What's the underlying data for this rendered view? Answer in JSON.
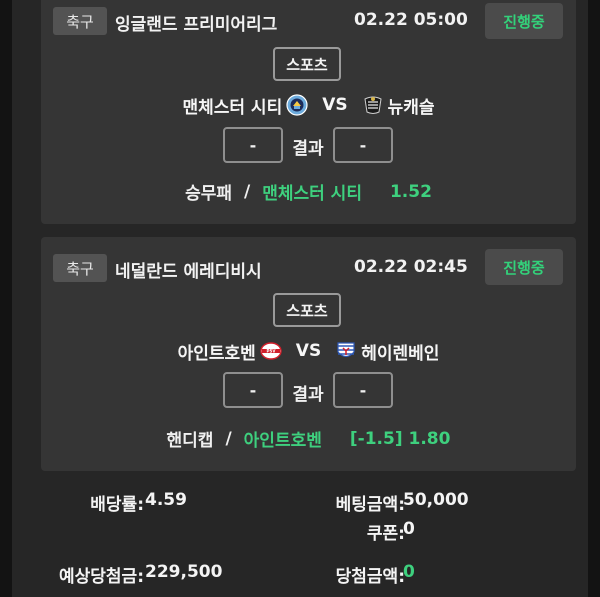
{
  "matches": [
    {
      "sport": "축구",
      "league": "잉글랜드 프리미어리그",
      "datetime": "02.22 05:00",
      "status": "진행중",
      "bet_category": "스포츠",
      "home_team": "맨체스터 시티",
      "vs": "VS",
      "away_team": "뉴캐슬",
      "home_score": "-",
      "result_label": "결과",
      "away_score": "-",
      "bet_type": "승무패",
      "slash": "/",
      "pick": "맨체스터 시티",
      "odds": "1.52",
      "home_logo": "man-city-crest-icon",
      "away_logo": "newcastle-crest-icon"
    },
    {
      "sport": "축구",
      "league": "네덜란드 에레디비시",
      "datetime": "02.22 02:45",
      "status": "진행중",
      "bet_category": "스포츠",
      "home_team": "아인트호벤",
      "vs": "VS",
      "away_team": "헤이렌베인",
      "home_score": "-",
      "result_label": "결과",
      "away_score": "-",
      "bet_type": "핸디캡",
      "slash": "/",
      "pick": "아인트호벤",
      "odds": "[-1.5] 1.80",
      "home_logo": "psv-crest-icon",
      "away_logo": "heerenveen-crest-icon"
    }
  ],
  "summary": {
    "odds_rate_label": "배당률:",
    "odds_rate_value": "4.59",
    "bet_amount_label": "베팅금액:",
    "bet_amount_value": "50,000",
    "coupon_label": "쿠폰:",
    "coupon_value": "0",
    "expected_win_label": "예상당첨금:",
    "expected_win_value": "229,500",
    "win_amount_label": "당첨금액:",
    "win_amount_value": "0"
  },
  "colors": {
    "accent_green": "#3ed07e",
    "card_bg": "#353535",
    "panel_bg": "#262626"
  }
}
